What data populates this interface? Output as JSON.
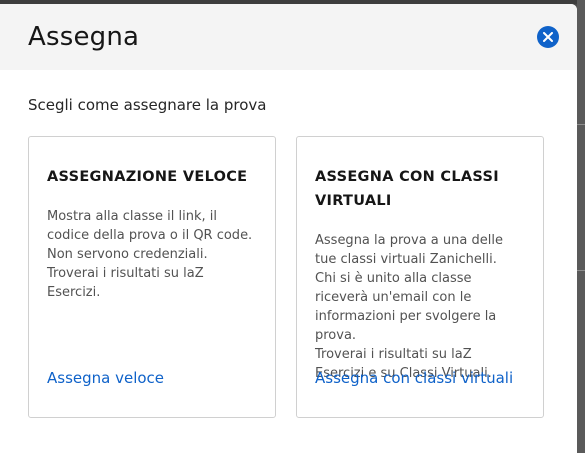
{
  "modal": {
    "title": "Assegna",
    "subtitle": "Scegli come assegnare la prova",
    "close_icon": "close-icon",
    "accent_color": "#0f62c9"
  },
  "cards": [
    {
      "title": "ASSEGNAZIONE VELOCE",
      "description": [
        "Mostra alla classe il link, il codice della prova o il QR code.",
        "Non servono credenziali.",
        "Troverai i risultati su laZ Esercizi."
      ],
      "link": "Assegna veloce"
    },
    {
      "title": "ASSEGNA CON CLASSI VIRTUALI",
      "description": [
        "Assegna la prova a una delle tue classi virtuali Zanichelli.",
        "Chi si è unito alla classe riceverà un'email con le informazioni per svolgere la prova.",
        "Troverai i risultati su laZ Esercizi e su Classi Virtuali."
      ],
      "link": "Assegna con classi virtuali"
    }
  ]
}
